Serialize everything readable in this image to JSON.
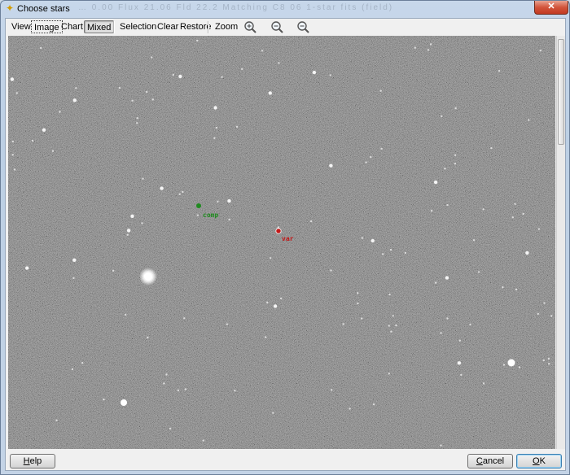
{
  "window": {
    "title": "Choose stars",
    "title_icon": "star-icon",
    "close_label": "✕",
    "ghost_title": "…  0.00   Flux   21.06   Fld   22.2  Matching C8 06  1-star fits (field)"
  },
  "toolbar": {
    "view_label": "View",
    "image_label": "Image",
    "chart_label": "Chart",
    "mixed_label": "Mixed",
    "selection_label": "Selection",
    "clear_label": "Clear",
    "restore_label": "Restore",
    "zoom_label": "Zoom",
    "zoom_in_icon": "zoom-in-icon",
    "zoom_fit_icon": "zoom-fit-icon",
    "zoom_out_icon": "zoom-out-icon"
  },
  "markers": {
    "comp": {
      "label": "comp",
      "color": "#1f8a1f"
    },
    "var": {
      "label": "var",
      "color": "#c21818"
    }
  },
  "buttons": {
    "help_label": "Help",
    "help_accel": "H",
    "cancel_label": "Cancel",
    "cancel_accel": "C",
    "ok_label": "OK",
    "ok_accel": "O"
  },
  "colors": {
    "sky_background": "#5e5e5e",
    "window_frame": "#bccfe4",
    "close_button": "#c23a22"
  }
}
